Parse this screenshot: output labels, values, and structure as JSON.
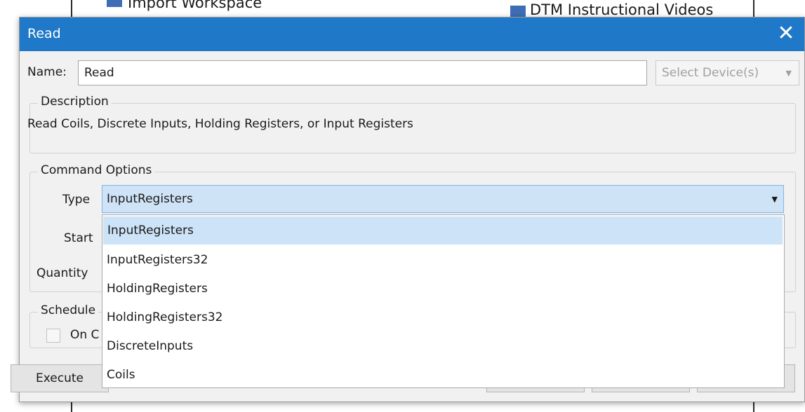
{
  "background": {
    "item_left": "Import Workspace",
    "item_right": "DTM Instructional Videos"
  },
  "dialog": {
    "title": "Read",
    "close_glyph": "✕",
    "name_label": "Name:",
    "name_value": "Read",
    "device_select_placeholder": "Select Device(s)",
    "caret_glyph": "▼",
    "description_title": "Description",
    "description_text": "Read Coils, Discrete Inputs, Holding Registers, or Input Registers",
    "command_options_title": "Command Options",
    "type_label": "Type",
    "type_selected": "InputRegisters",
    "start_label": "Start",
    "quantity_label": "Quantity",
    "schedule_title": "Schedule",
    "on_checkbox_label": "On C",
    "execute_button": "Execute",
    "type_options": [
      "InputRegisters",
      "InputRegisters32",
      "HoldingRegisters",
      "HoldingRegisters32",
      "DiscreteInputs",
      "Coils"
    ]
  },
  "colors": {
    "titlebar": "#1f78c8",
    "selection": "#cde3f7",
    "dialog_bg": "#f1f1f1"
  }
}
